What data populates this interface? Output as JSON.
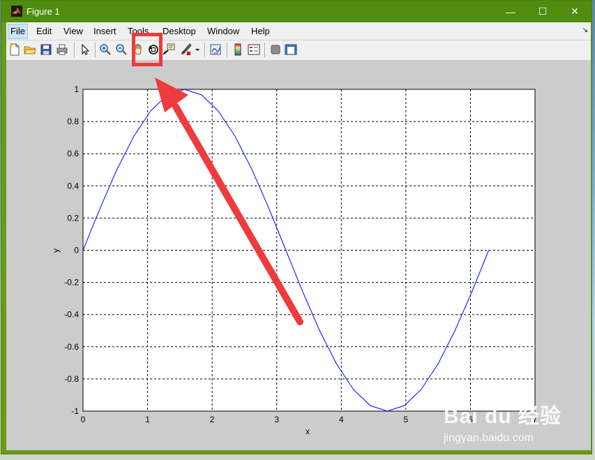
{
  "window": {
    "title": "Figure 1",
    "minimize_glyph": "—",
    "maximize_glyph": "☐",
    "close_glyph": "✕"
  },
  "menu": {
    "items": [
      "File",
      "Edit",
      "View",
      "Insert",
      "Tools",
      "Desktop",
      "Window",
      "Help"
    ],
    "overflow_glyph": "↘"
  },
  "toolbar": {
    "buttons": [
      {
        "icon": "new-figure-icon"
      },
      {
        "icon": "open-file-icon"
      },
      {
        "icon": "save-icon"
      },
      {
        "icon": "print-icon"
      },
      {
        "icon": "select-arrow-icon"
      },
      {
        "icon": "zoom-in-icon"
      },
      {
        "icon": "zoom-out-icon"
      },
      {
        "icon": "pan-hand-icon"
      },
      {
        "icon": "rotate-3d-icon"
      },
      {
        "icon": "data-cursor-icon"
      },
      {
        "icon": "brush-icon"
      },
      {
        "icon": "link-plot-icon"
      },
      {
        "icon": "colorbar-icon"
      },
      {
        "icon": "legend-icon"
      },
      {
        "icon": "hide-plot-tools-icon"
      },
      {
        "icon": "show-plot-tools-icon"
      }
    ]
  },
  "annotation": {
    "highlight_color": "#ee3b3b",
    "arrow_color": "#ee3b3b"
  },
  "watermark": {
    "logo": "Bai du 经验",
    "url": "jingyan.baidu.com"
  },
  "chart_data": {
    "type": "line",
    "title": "",
    "xlabel": "x",
    "ylabel": "y",
    "xlim": [
      0,
      7
    ],
    "ylim": [
      -1,
      1
    ],
    "xticks": [
      "0",
      "1",
      "2",
      "3",
      "4",
      "5",
      "6",
      "7"
    ],
    "yticks": [
      "1",
      "0.8",
      "0.6",
      "0.4",
      "0.2",
      "0",
      "-0.2",
      "-0.4",
      "-0.6",
      "-0.8",
      "-1"
    ],
    "grid": true,
    "series": [
      {
        "color": "#0000ff",
        "x": [
          0,
          0.2618,
          0.5236,
          0.7854,
          1.0472,
          1.309,
          1.5708,
          1.8326,
          2.0944,
          2.3562,
          2.618,
          2.8798,
          3.1416,
          3.4034,
          3.6652,
          3.927,
          4.1888,
          4.4506,
          4.7124,
          4.9742,
          5.236,
          5.4978,
          5.7596,
          6.0214,
          6.2832
        ],
        "y": [
          0,
          0.2588,
          0.5,
          0.7071,
          0.866,
          0.9659,
          1,
          0.9659,
          0.866,
          0.7071,
          0.5,
          0.2588,
          0,
          -0.2588,
          -0.5,
          -0.7071,
          -0.866,
          -0.9659,
          -1,
          -0.9659,
          -0.866,
          -0.7071,
          -0.5,
          -0.2588,
          0
        ]
      }
    ]
  }
}
